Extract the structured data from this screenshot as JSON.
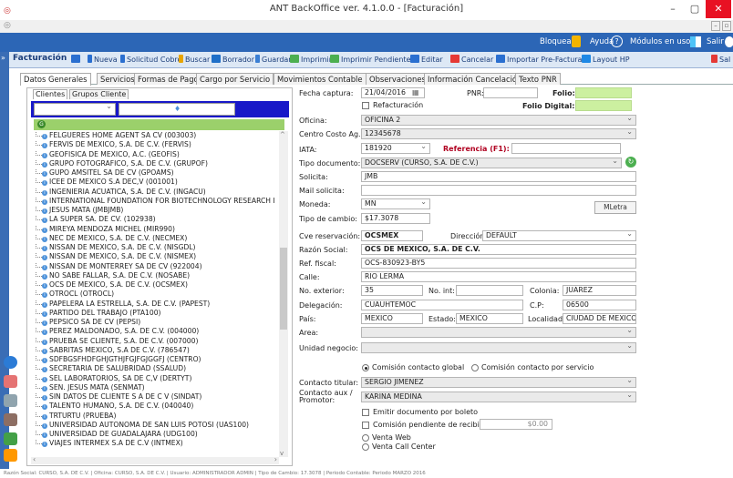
{
  "window": {
    "title": "ANT BackOffice ver. 4.1.0.0 - [Facturación]",
    "minimize": "–",
    "maximize": "▢",
    "close": "✕"
  },
  "topbar": {
    "bloquear": "Bloquear",
    "ayuda": "Ayuda",
    "modulos": "Módulos en uso",
    "salir": "Salir"
  },
  "toolbar": {
    "title": "Facturación",
    "nueva": "Nueva",
    "solicitud": "Solicitud Cobro",
    "buscar": "Buscar",
    "borrador": "Borrador",
    "guardar": "Guardar",
    "imprimir": "Imprimir",
    "imprimir_pend": "Imprimir Pendientes",
    "editar": "Editar",
    "cancelar": "Cancelar",
    "importar": "Importar Pre-Factura",
    "layout": "Layout HP",
    "salir": "Sal"
  },
  "tabs": [
    "Datos Generales",
    "Servicios",
    "Formas de Pago",
    "Cargo por Servicio",
    "Movimientos Contable",
    "Observaciones",
    "Información Cancelación",
    "Texto PNR"
  ],
  "client_tabs": [
    "Clientes",
    "Grupos Cliente"
  ],
  "clients": [
    "FELGUERES HOME AGENT SA CV (003003)",
    "FERVIS DE MEXICO, S.A. DE C.V. (FERVIS)",
    "GEOFISICA DE MEXICO, A.C. (GEOFIS)",
    "GRUPO FOTOGRAFICO, S.A. DE C.V. (GRUPOF)",
    "GUPO AMSITEL SA DE CV (GPOAMS)",
    "ICEE DE MEXICO S.A DEC,V (001001)",
    "INGENIERIA ACUATICA, S.A. DE C.V. (INGACU)",
    "INTERNATIONAL FOUNDATION FOR BIOTECHNOLOGY RESEARCH I",
    "JESUS MATA (JMBJMB)",
    "LA SUPER SA. DE CV. (102938)",
    "MIREYA MENDOZA MICHEL (MIR990)",
    "NEC DE MEXICO, S.A. DE C.V. (NECMEX)",
    "NISSAN DE MEXICO, S.A. DE C.V. (NISGDL)",
    "NISSAN DE MEXICO, S.A. DE C.V. (NISMEX)",
    "NISSAN DE MONTERREY SA DE CV (922004)",
    "NO SABE FALLAR, S.A. DE C.V. (NOSABE)",
    "OCS DE MEXICO, S.A. DE C.V. (OCSMEX)",
    "OTROCL (OTROCL)",
    "PAPELERA LA ESTRELLA, S.A. DE C.V. (PAPEST)",
    "PARTIDO DEL TRABAJO (PTA100)",
    "PEPSICO SA DE CV (PEPSI)",
    "PEREZ MALDONADO, S.A. DE C.V. (004000)",
    "PRUEBA SE CLIENTE, S.A. DE C.V. (007000)",
    "SABRITAS MEXICO, S.A DE C.V. (786547)",
    "SDFBGSFHDFGHJGTHJFGJFGJGGFJ (CENTRO)",
    "SECRETARIA DE SALUBRIDAD (SSALUD)",
    "SEL LABORATORIOS, SA DE C,V (DERTYT)",
    "SEN. JESUS MATA (SENMAT)",
    "SIN DATOS DE CLIENTE S A DE C V (SINDAT)",
    "TALENTO HUMANO, S.A. DE C.V. (040040)",
    "TRTURTU (PRUEBA)",
    "UNIVERSIDAD AUTONOMA DE SAN LUIS POTOSI (UAS100)",
    "UNIVERSIDAD DE GUADALAJARA (UDG100)",
    "VIAJES INTERMEX S.A DE C.V (INTMEX)"
  ],
  "form": {
    "fecha_label": "Fecha captura:",
    "fecha_value": "21/04/2016",
    "pnr_label": "PNR:",
    "folio_label": "Folio:",
    "refact_label": "Refacturación",
    "folio_digital_label": "Folio Digital:",
    "oficina_label": "Oficina:",
    "oficina_value": "OFICINA 2",
    "centro_label": "Centro Costo Ag.:",
    "centro_value": "12345678",
    "iata_label": "IATA:",
    "iata_value": "181920",
    "ref_label": "Referencia (F1):",
    "tipo_doc_label": "Tipo documento:",
    "tipo_doc_value": "DOCSERV (CURSO, S.A. DE C.V.)",
    "solicita_label": "Solicita:",
    "solicita_value": "JMB",
    "mail_label": "Mail solicita:",
    "moneda_label": "Moneda:",
    "moneda_value": "MN",
    "mletra_label": "MLetra",
    "tipo_cambio_label": "Tipo de cambio:",
    "tipo_cambio_value": "$17.3078",
    "cve_label": "Cve reservación:",
    "cve_value": "OCSMEX",
    "direccion_label": "Dirección:",
    "direccion_value": "DEFAULT",
    "razon_label": "Razón Social:",
    "razon_value": "OCS DE MEXICO, S.A. DE C.V.",
    "rfc_label": "Ref. fiscal:",
    "rfc_value": "OCS-830923-BY5",
    "calle_label": "Calle:",
    "calle_value": "RIO LERMA",
    "noext_label": "No. exterior:",
    "noext_value": "35",
    "noint_label": "No. int:",
    "colonia_label": "Colonia:",
    "colonia_value": "JUAREZ",
    "delegacion_label": "Delegación:",
    "delegacion_value": "CUAUHTEMOC",
    "cp_label": "C.P:",
    "cp_value": "06500",
    "pais_label": "País:",
    "pais_value": "MEXICO",
    "estado_label": "Estado:",
    "estado_value": "MEXICO",
    "localidad_label": "Localidad:",
    "localidad_value": "CIUDAD DE MEXICO",
    "area_label": "Area:",
    "unidad_label": "Unidad negocio:",
    "comision_global": "Comisión contacto global",
    "comision_servicio": "Comisión contacto por servicio",
    "contacto_label": "Contacto titular:",
    "contacto_value": "SERGIO JIMENEZ",
    "contacto_aux_label": "Contacto aux /",
    "promotor_label": "Promotor:",
    "promotor_value": "KARINA MEDINA",
    "emitir_label": "Emitir documento por boleto",
    "comision_pend_label": "Comisión pendiente de recibir:",
    "comision_pend_value": "$0.00",
    "venta_web": "Venta Web",
    "venta_call": "Venta Call Center"
  },
  "status": "Razón Social: CURSO, S.A. DE C.V. | Oficina: CURSO, S.A. DE C.V. | Usuario: ADMINISTRADOR ADMIN | Tipo de Cambio: 17.3078 | Periodo Contable: Periodo MARZO 2016"
}
